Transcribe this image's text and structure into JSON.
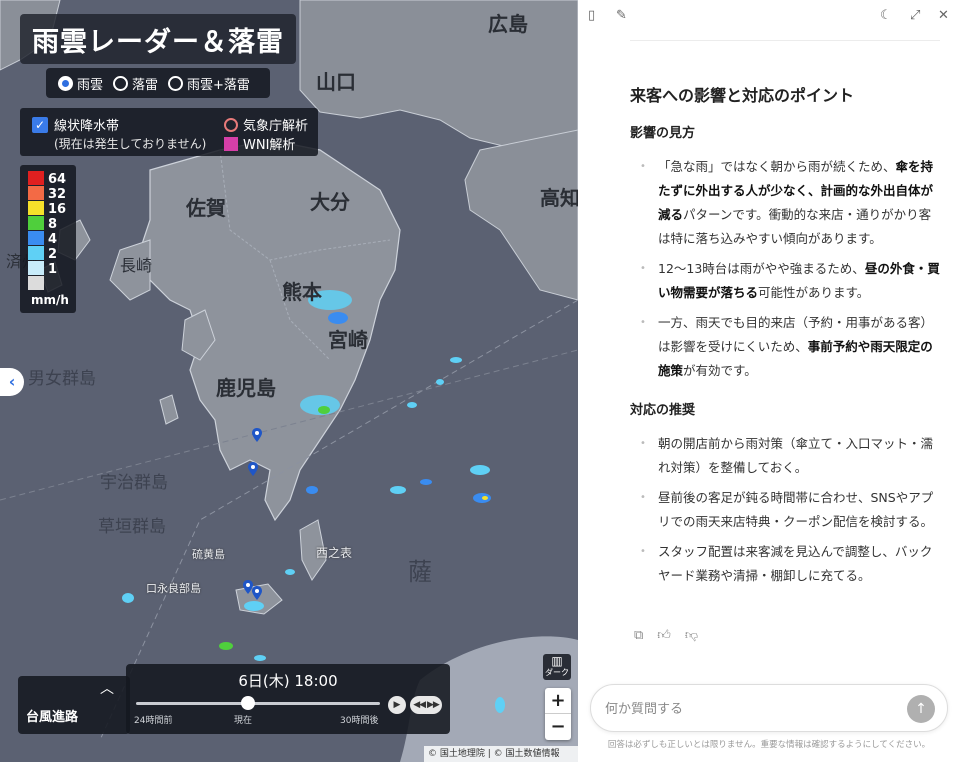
{
  "map": {
    "title": "雨雲レーダー＆落雷",
    "modes": [
      {
        "label": "雨雲",
        "selected": true
      },
      {
        "label": "落雷",
        "selected": false
      },
      {
        "label": "雨雲+落雷",
        "selected": false
      }
    ],
    "options": {
      "linear_rain_label": "線状降水帯",
      "linear_rain_checked": true,
      "linear_rain_status": "(現在は発生しておりません)",
      "jma_label": "気象庁解析",
      "wni_label": "WNI解析"
    },
    "legend": {
      "levels": [
        {
          "value": "64",
          "color": "#e02020"
        },
        {
          "value": "32",
          "color": "#f36a45"
        },
        {
          "value": "16",
          "color": "#f5e12a"
        },
        {
          "value": "8",
          "color": "#4fcf3c"
        },
        {
          "value": "4",
          "color": "#3a8cf0"
        },
        {
          "value": "2",
          "color": "#5fd0f5"
        },
        {
          "value": "1",
          "color": "#c8ecfa"
        },
        {
          "value": "",
          "color": "#dcdcdc"
        }
      ],
      "unit": "mm/h"
    },
    "place_labels": {
      "hiroshima": "広島",
      "yamaguchi": "山口",
      "kochi": "高知",
      "saga": "佐賀",
      "oita": "大分",
      "kumamoto": "熊本",
      "miyazaki": "宮崎",
      "kagoshima": "鹿児島",
      "nagasaki": "長崎",
      "danjo": "男女群島",
      "uji": "宇治群島",
      "kusagaki": "草垣群島",
      "nishinoomote": "西之表",
      "kuchinoerabu": "口永良部島",
      "iojima": "硫黄島",
      "satsuma": "薩",
      "jeju": "済州"
    },
    "time": {
      "current": "6日(木) 18:00",
      "start_label": "24時間前",
      "now_label": "現在",
      "end_label": "30時間後",
      "position_fraction": 0.46
    },
    "typhoon_label": "台風進路",
    "dark_label": "ダーク",
    "attribution": [
      "© 国土地理院",
      "© 国土数値情報"
    ]
  },
  "chat": {
    "heading": "来客への影響と対応のポイント",
    "section1_title": "影響の見方",
    "section1_items": [
      [
        "「急な雨」ではなく朝から雨が続くため、",
        "傘を持たずに外出する人が少なく、計画的な外出自体が減る",
        "パターンです。衝動的な来店・通りがかり客は特に落ち込みやすい傾向があります。"
      ],
      [
        "12〜13時台は雨がやや強まるため、",
        "昼の外食・買い物需要が落ちる",
        "可能性があります。"
      ],
      [
        "一方、雨天でも目的来店（予約・用事がある客）は影響を受けにくいため、",
        "事前予約や雨天限定の施策",
        "が有効です。"
      ]
    ],
    "section2_title": "対応の推奨",
    "section2_items": [
      "朝の開店前から雨対策（傘立て・入口マット・濡れ対策）を整備しておく。",
      "昼前後の客足が鈍る時間帯に合わせ、SNSやアプリでの雨天来店特典・クーポン配信を検討する。",
      "スタッフ配置は来客減を見込んで調整し、バックヤード業務や清掃・棚卸しに充てる。"
    ],
    "input_placeholder": "何か質問する",
    "disclaimer": "回答は必ずしも正しいとは限りません。重要な情報は確認するようにしてください。"
  }
}
